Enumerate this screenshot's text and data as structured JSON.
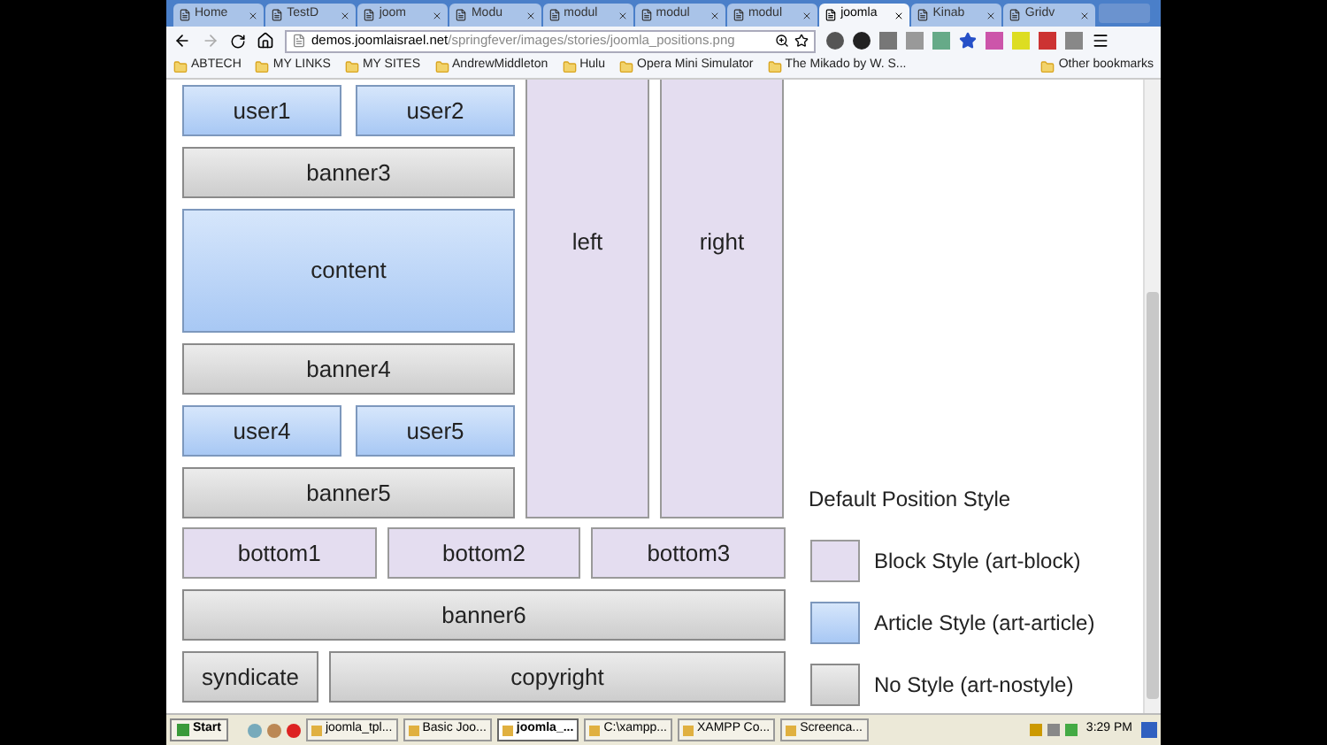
{
  "tabs": [
    {
      "label": "Home",
      "selected": false
    },
    {
      "label": "TestD",
      "selected": false
    },
    {
      "label": "joom",
      "selected": false
    },
    {
      "label": "Modu",
      "selected": false
    },
    {
      "label": "modul",
      "selected": false
    },
    {
      "label": "modul",
      "selected": false
    },
    {
      "label": "modul",
      "selected": false
    },
    {
      "label": "joomla",
      "selected": true
    },
    {
      "label": "Kinab",
      "selected": false
    },
    {
      "label": "Gridv",
      "selected": false
    }
  ],
  "address_bar": {
    "host": "demos.joomlaisrael.net",
    "path": "/springfever/images/stories/joomla_positions.png"
  },
  "bookmarks": [
    "ABTECH",
    "MY LINKS",
    "MY SITES",
    "AndrewMiddleton",
    "Hulu",
    "Opera Mini Simulator",
    "The Mikado by W. S..."
  ],
  "other_bookmarks": "Other bookmarks",
  "diagram": {
    "upper_rows": [
      [
        {
          "label": "user1",
          "kind": "article"
        },
        {
          "label": "user2",
          "kind": "article"
        }
      ],
      [
        {
          "label": "banner3",
          "kind": "nostyle"
        }
      ],
      [
        {
          "label": "content",
          "kind": "article"
        }
      ],
      [
        {
          "label": "banner4",
          "kind": "nostyle"
        }
      ],
      [
        {
          "label": "user4",
          "kind": "article"
        },
        {
          "label": "user5",
          "kind": "article"
        }
      ],
      [
        {
          "label": "banner5",
          "kind": "nostyle"
        }
      ]
    ],
    "columns": [
      {
        "label": "left",
        "kind": "block"
      },
      {
        "label": "right",
        "kind": "block"
      }
    ],
    "lower_rows": [
      [
        {
          "label": "bottom1",
          "kind": "block"
        },
        {
          "label": "bottom2",
          "kind": "block"
        },
        {
          "label": "bottom3",
          "kind": "block"
        }
      ],
      [
        {
          "label": "banner6",
          "kind": "nostyle"
        }
      ],
      [
        {
          "label": "syndicate",
          "kind": "nostyle"
        },
        {
          "label": "copyright",
          "kind": "nostyle"
        }
      ]
    ]
  },
  "legend": {
    "title": "Default Position Style",
    "items": [
      {
        "label": "Block Style (art-block)",
        "kind": "block"
      },
      {
        "label": "Article Style (art-article)",
        "kind": "article"
      },
      {
        "label": "No Style (art-nostyle)",
        "kind": "nostyle"
      }
    ]
  },
  "taskbar": {
    "start": "Start",
    "items": [
      {
        "label": "joomla_tpl...",
        "selected": false
      },
      {
        "label": "Basic Joo...",
        "selected": false
      },
      {
        "label": "joomla_...",
        "selected": true
      },
      {
        "label": "C:\\xampp...",
        "selected": false
      },
      {
        "label": "XAMPP Co...",
        "selected": false
      },
      {
        "label": "Screenca...",
        "selected": false
      }
    ],
    "clock": "3:29 PM"
  }
}
